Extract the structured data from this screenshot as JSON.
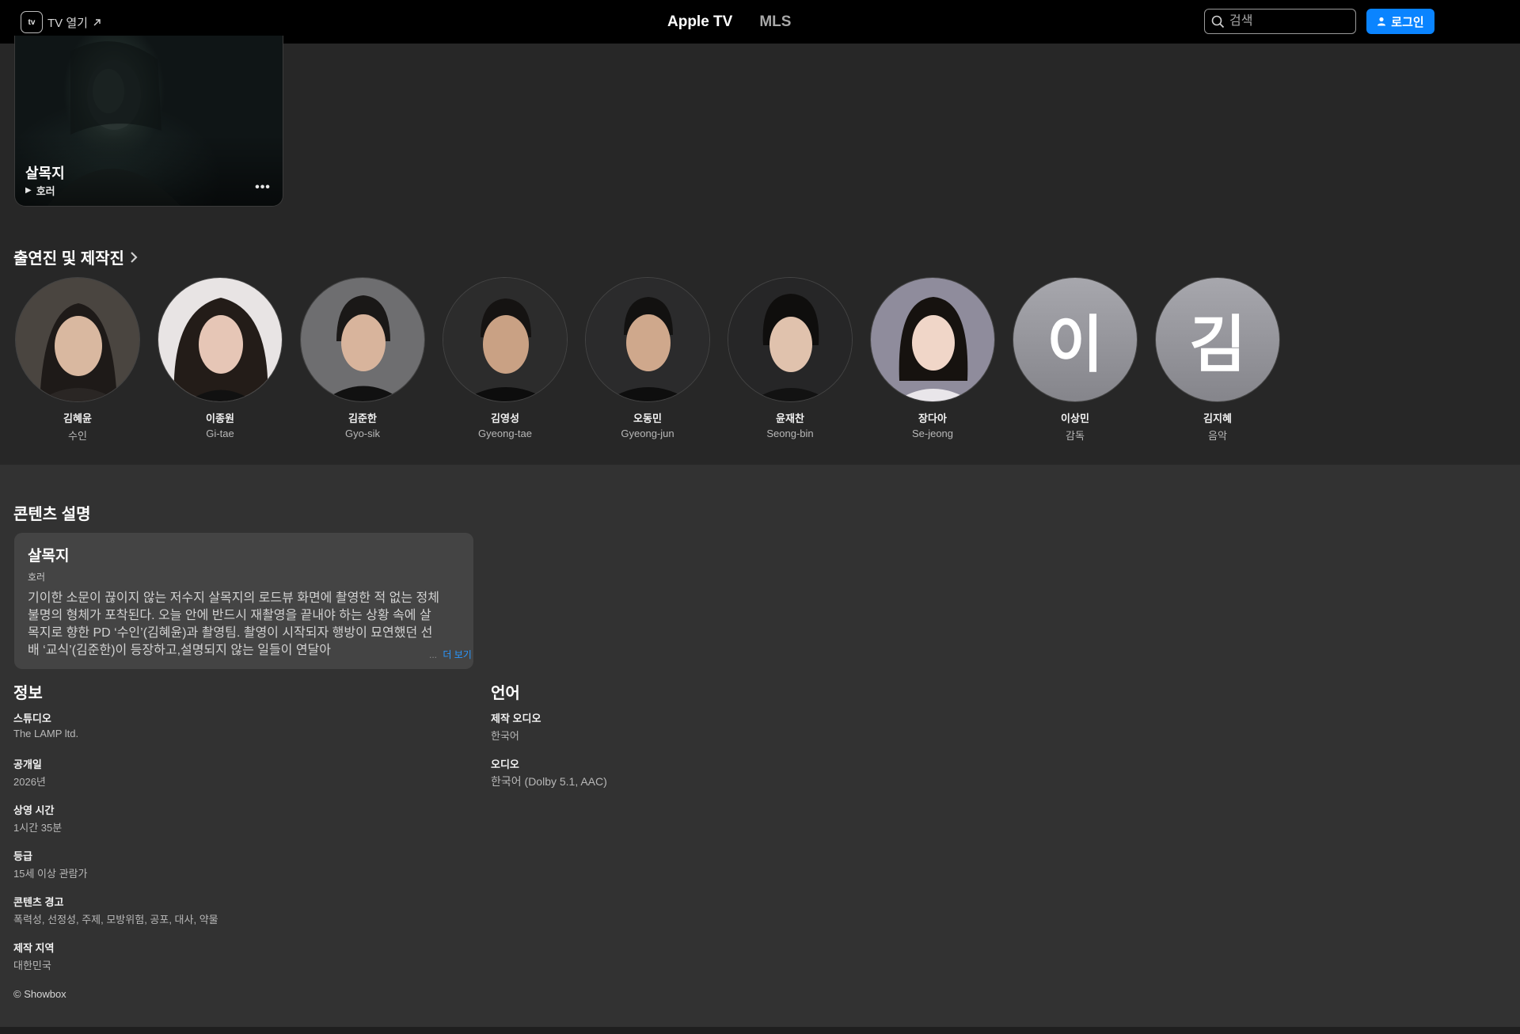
{
  "nav": {
    "tv_open_label": "TV 열기",
    "tv_badge": "tv",
    "items": [
      {
        "label": "Apple TV"
      },
      {
        "label": "MLS"
      }
    ],
    "search_placeholder": "검색",
    "login_label": "로그인"
  },
  "hero": {
    "title": "살목지",
    "genre": "호러",
    "play_glyph": "▶",
    "more_glyph": "•••"
  },
  "cast": {
    "header": "출연진 및 제작진",
    "members": [
      {
        "name": "김혜윤",
        "role": "수인"
      },
      {
        "name": "이종원",
        "role": "Gi-tae"
      },
      {
        "name": "김준한",
        "role": "Gyo-sik"
      },
      {
        "name": "김영성",
        "role": "Gyeong-tae"
      },
      {
        "name": "오동민",
        "role": "Gyeong-jun"
      },
      {
        "name": "윤재찬",
        "role": "Seong-bin"
      },
      {
        "name": "장다아",
        "role": "Se-jeong"
      },
      {
        "name": "이상민",
        "role": "감독",
        "initial": "이"
      },
      {
        "name": "김지혜",
        "role": "음악",
        "initial": "김"
      }
    ]
  },
  "description": {
    "section_title": "콘텐츠 설명",
    "title": "살목지",
    "genre": "호러",
    "body": "기이한 소문이 끊이지 않는 저수지 살목지의 로드뷰 화면에 촬영한 적 없는 정체불명의 형체가 포착된다. 오늘 안에 반드시 재촬영을 끝내야 하는 상황 속에 살목지로 향한 PD ‘수인’(김혜윤)과 촬영팀. 촬영이 시작되자 행방이 묘연했던 선배 ‘교식’(김준한)이 등장하고,설명되지 않는 일들이 연달아",
    "ellipsis": "...",
    "more_label": "더 보기"
  },
  "info": {
    "section_title": "정보",
    "items": [
      {
        "key": "스튜디오",
        "value": "The LAMP ltd."
      },
      {
        "key": "공개일",
        "value": "2026년"
      },
      {
        "key": "상영 시간",
        "value": "1시간 35분"
      },
      {
        "key": "등급",
        "value": "15세 이상 관람가"
      },
      {
        "key": "콘텐츠 경고",
        "value": "폭력성, 선정성, 주제, 모방위험, 공포, 대사, 약물"
      },
      {
        "key": "제작 지역",
        "value": "대한민국"
      }
    ],
    "copyright": "© Showbox"
  },
  "language": {
    "section_title": "언어",
    "items": [
      {
        "key": "제작 오디오",
        "value": "한국어"
      },
      {
        "key": "오디오",
        "value": "한국어 (Dolby 5.1, AAC)"
      }
    ]
  },
  "colors": {
    "accent": "#0a84ff",
    "link": "#2997ff",
    "background": "#272727",
    "panel": "#323232",
    "nav_bg": "#000000"
  }
}
